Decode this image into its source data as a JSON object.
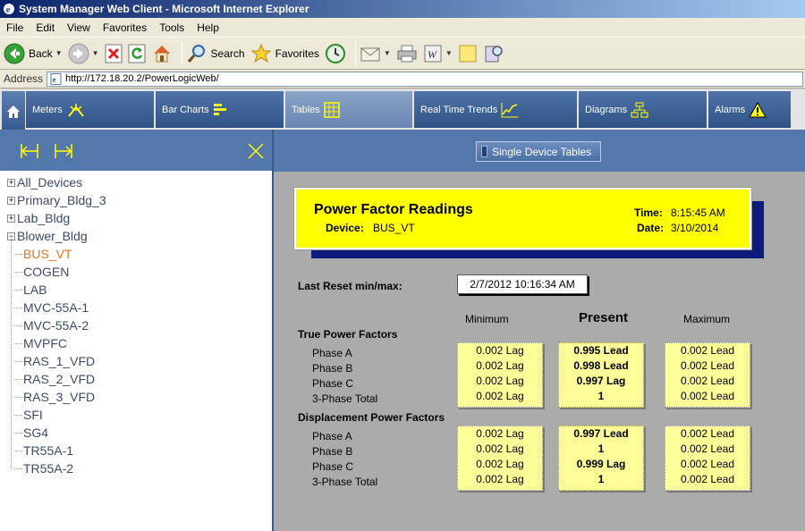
{
  "window": {
    "title": "System Manager Web Client - Microsoft Internet Explorer"
  },
  "menu": [
    "File",
    "Edit",
    "View",
    "Favorites",
    "Tools",
    "Help"
  ],
  "toolbar": {
    "back": "Back",
    "search": "Search",
    "favorites": "Favorites"
  },
  "address": {
    "label": "Address",
    "url": "http://172.18.20.2/PowerLogicWeb/"
  },
  "nav": {
    "tabs": [
      {
        "label": "Meters",
        "icon": "meter-icon"
      },
      {
        "label": "Bar Charts",
        "icon": "bar-chart-icon"
      },
      {
        "label": "Tables",
        "icon": "table-icon",
        "active": true
      },
      {
        "label": "Real Time Trends",
        "icon": "trend-icon"
      },
      {
        "label": "Diagrams",
        "icon": "diagram-icon"
      },
      {
        "label": "Alarms",
        "icon": "warning-icon"
      }
    ]
  },
  "tree": {
    "roots": [
      "All_Devices",
      "Primary_Bldg_3",
      "Lab_Bldg",
      "Blower_Bldg"
    ],
    "children": [
      "BUS_VT",
      "COGEN",
      "LAB",
      "MVC-55A-1",
      "MVC-55A-2",
      "MVPFC",
      "RAS_1_VFD",
      "RAS_2_VFD",
      "RAS_3_VFD",
      "SFI",
      "SG4",
      "TR55A-1",
      "TR55A-2"
    ],
    "selected": "BUS_VT"
  },
  "right": {
    "single_device_tables": "Single Device Tables",
    "title": "Power Factor Readings",
    "device_label": "Device:",
    "device": "BUS_VT",
    "time_label": "Time:",
    "time": "8:15:45 AM",
    "date_label": "Date:",
    "date": "3/10/2014",
    "reset_label": "Last Reset min/max:",
    "reset_value": "2/7/2012 10:16:34 AM",
    "col_min": "Minimum",
    "col_present": "Present",
    "col_max": "Maximum",
    "true_pf": "True Power Factors",
    "disp_pf": "Displacement Power Factors",
    "phases": [
      "Phase A",
      "Phase B",
      "Phase C",
      "3-Phase Total"
    ],
    "true_min": [
      "0.002 Lag",
      "0.002 Lag",
      "0.002 Lag",
      "0.002 Lag"
    ],
    "true_present": [
      "0.995 Lead",
      "0.998 Lead",
      "0.997 Lag",
      "1"
    ],
    "true_max": [
      "0.002 Lead",
      "0.002 Lead",
      "0.002 Lead",
      "0.002 Lead"
    ],
    "disp_min": [
      "0.002 Lag",
      "0.002 Lag",
      "0.002 Lag",
      "0.002 Lag"
    ],
    "disp_present": [
      "0.997 Lead",
      "1",
      "0.999 Lag",
      "1"
    ],
    "disp_max": [
      "0.002 Lead",
      "0.002 Lead",
      "0.002 Lead",
      "0.002 Lead"
    ]
  }
}
